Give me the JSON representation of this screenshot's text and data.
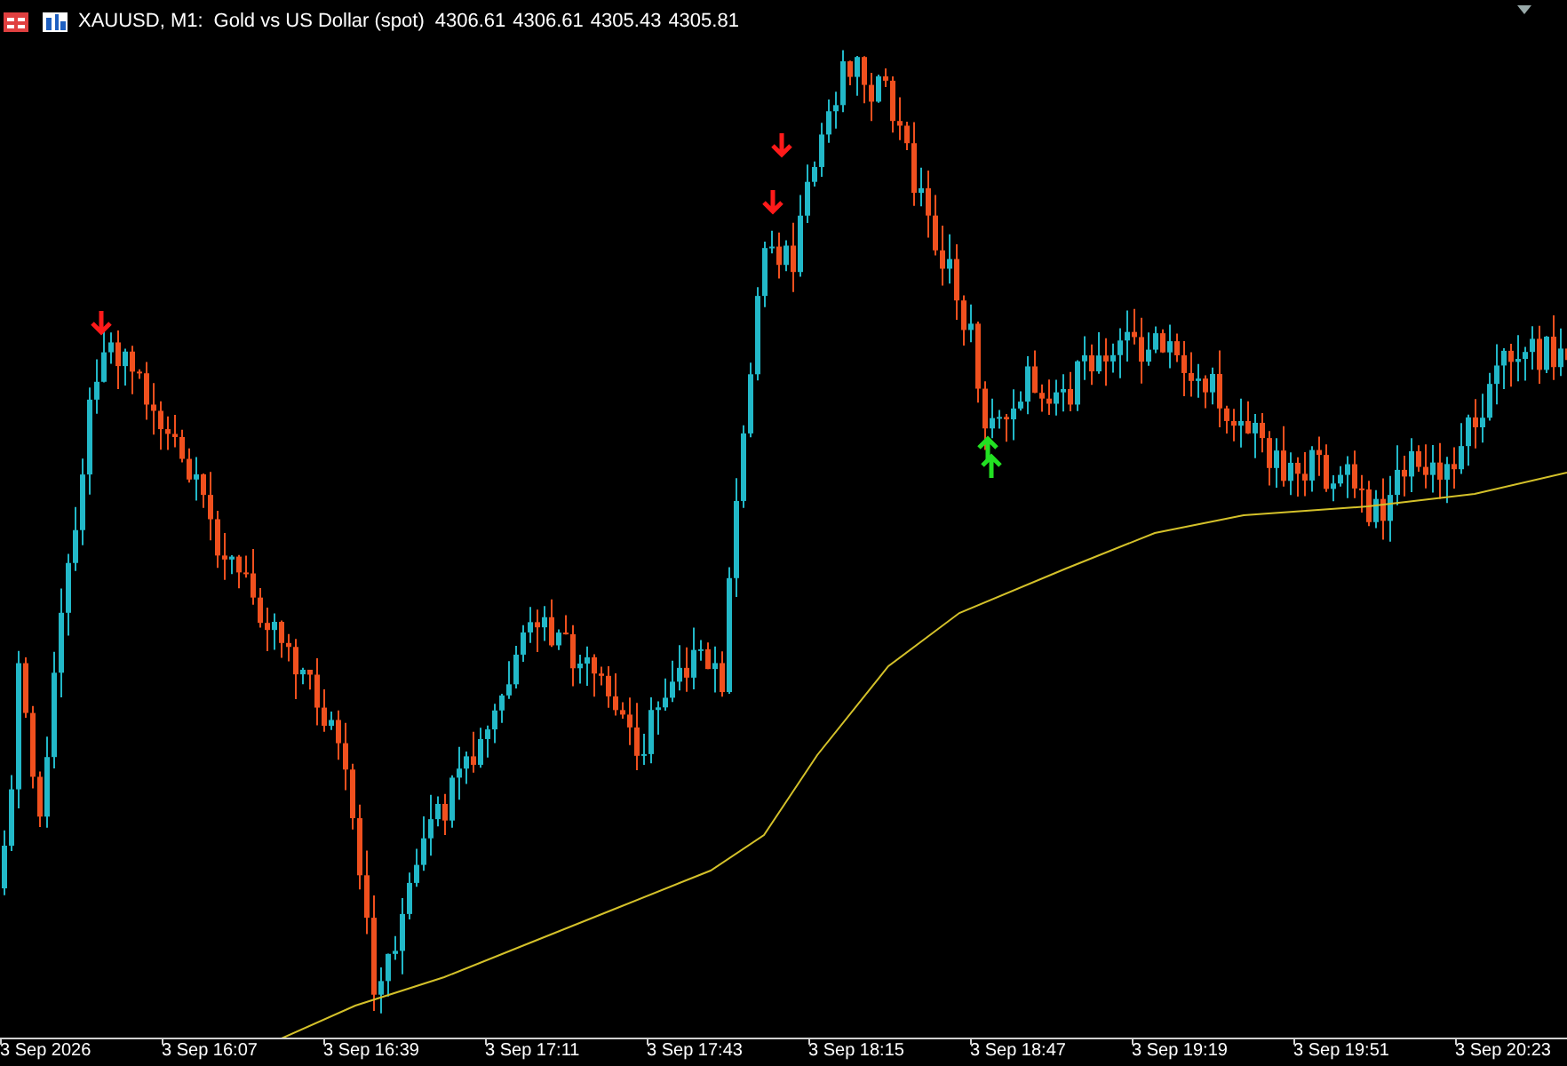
{
  "chart_header": {
    "symbol": "XAUUSD, M1:",
    "description": "Gold vs US Dollar (spot)",
    "quotes": [
      "4306.61",
      "4306.61",
      "4305.43",
      "4305.81"
    ]
  },
  "time_axis": {
    "labels": [
      "3 Sep 2026",
      "3 Sep 16:07",
      "3 Sep 16:39",
      "3 Sep 17:11",
      "3 Sep 17:43",
      "3 Sep 18:15",
      "3 Sep 18:47",
      "3 Sep 19:19",
      "3 Sep 19:51",
      "3 Sep 20:23"
    ]
  }
}
